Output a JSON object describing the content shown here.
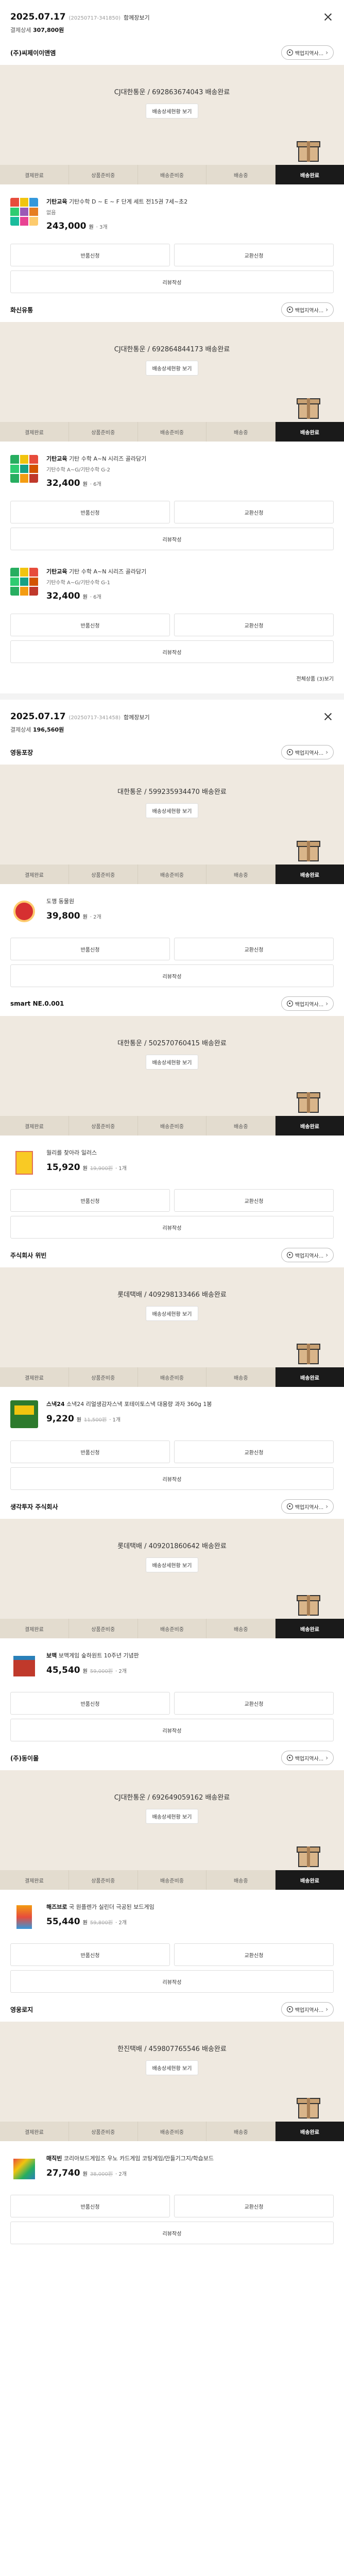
{
  "orders": [
    {
      "date": "2025.07.17",
      "order_no": "(20250717-341850)",
      "detail_label": "함께장보기",
      "pay_label": "결제상세",
      "pay_amount": "307,800원",
      "more_label": "전체상품 (3)보기",
      "shops": [
        {
          "name": "(주)씨제이이앤엠",
          "cs_label": "백업지역사...",
          "carrier": "CJ대한통운 / 692863674043 배송완료",
          "track_label": "배송상세현황 보기",
          "items": [
            {
              "thumb": "grid-multi",
              "brand": "기탄교육",
              "title": " 기탄수학 D ~ E ~ F 단계 세트 전15권 7세~초2",
              "opt": "없음",
              "price": "243,000",
              "won": "원",
              "orig": "",
              "qty": "· 3개"
            }
          ]
        },
        {
          "name": "화신유통",
          "cs_label": "백업지역사...",
          "carrier": "CJ대한통운 / 692864844173 배송완료",
          "track_label": "배송상세현황 보기",
          "items": [
            {
              "thumb": "grid-green",
              "brand": "기탄교육",
              "title": " 기탄 수학 A~N 시리즈 골라담기",
              "opt": "기탄수학 A~G/기탄수학 G-2",
              "price": "32,400",
              "won": "원",
              "orig": "",
              "qty": "· 6개"
            },
            {
              "thumb": "grid-green",
              "brand": "기탄교육",
              "title": " 기탄 수학 A~N 시리즈 골라담기",
              "opt": "기탄수학 A~G/기탄수학 G-1",
              "price": "32,400",
              "won": "원",
              "orig": "",
              "qty": "· 6개"
            }
          ]
        }
      ]
    },
    {
      "date": "2025.07.17",
      "order_no": "(20250717-341458)",
      "detail_label": "함께장보기",
      "pay_label": "결제상세",
      "pay_amount": "196,560원",
      "more_label": "",
      "shops": [
        {
          "name": "영동포장",
          "cs_label": "백업지역사...",
          "carrier": "대한통운 / 599235934470 배송완료",
          "track_label": "배송상세현황 보기",
          "items": [
            {
              "thumb": "round-red",
              "brand": "",
              "title": "도깽 동물원",
              "opt": "",
              "price": "39,800",
              "won": "원",
              "orig": "",
              "qty": "· 2개"
            }
          ]
        },
        {
          "name": "smart NE.0.001",
          "cs_label": "백업지역사...",
          "carrier": "대한통운 / 502570760415 배송완료",
          "track_label": "배송상세현황 보기",
          "items": [
            {
              "thumb": "book-yellow",
              "brand": "",
              "title": "월리를 찾아라 일러스",
              "opt": "",
              "price": "15,920",
              "won": "원",
              "orig": "19,900원",
              "qty": "· 1개"
            }
          ]
        },
        {
          "name": "주식회사 위빈",
          "cs_label": "백업지역사...",
          "carrier": "롯데택배 / 409298133466 배송완료",
          "track_label": "배송상세현황 보기",
          "items": [
            {
              "thumb": "box-green",
              "brand": "스낵24",
              "title": " 소낵24 리얼생감자스낵 포테이토스낵 대용량 과자 360g 1봉",
              "opt": "",
              "price": "9,220",
              "won": "원",
              "orig": "11,500원",
              "qty": "· 1개"
            }
          ]
        },
        {
          "name": "생각투자 주식회사",
          "cs_label": "백업지역사...",
          "carrier": "롯데택배 / 409201860642 배송완료",
          "track_label": "배송상세현황 보기",
          "items": [
            {
              "thumb": "box-red",
              "brand": "보맥",
              "title": " 보맥게임 숲하원트 10주년 기념판",
              "opt": "",
              "price": "45,540",
              "won": "원",
              "orig": "59,000원",
              "qty": "· 2개"
            }
          ]
        },
        {
          "name": "(주)동이몰",
          "cs_label": "백업지역사...",
          "carrier": "CJ대한통운 / 692649059162 배송완료",
          "track_label": "배송상세현황 보기",
          "items": [
            {
              "thumb": "box-multi",
              "brand": "해즈브로",
              "title": " 국 원플렌가 실린더 극공된 보드게임",
              "opt": "",
              "price": "55,440",
              "won": "원",
              "orig": "59,800원",
              "qty": "· 2개"
            }
          ]
        },
        {
          "name": "영웅로지",
          "cs_label": "백업지역사...",
          "carrier": "한진택배 / 459807765546 배송완료",
          "track_label": "배송상세현황 보기",
          "items": [
            {
              "thumb": "box-mix",
              "brand": "매직빈",
              "title": " 코리아보드게임즈 우노 카드게임 코팅게임/만들기그지/학습보드",
              "opt": "",
              "price": "27,740",
              "won": "원",
              "orig": "38,000원",
              "qty": "· 2개"
            }
          ]
        }
      ]
    }
  ],
  "steps": [
    "결제완료",
    "상품준비중",
    "배송준비중",
    "배송중",
    "배송완료"
  ],
  "actions": {
    "return_label": "반품신청",
    "exchange_label": "교환신청",
    "review_label": "리뷰작성"
  }
}
